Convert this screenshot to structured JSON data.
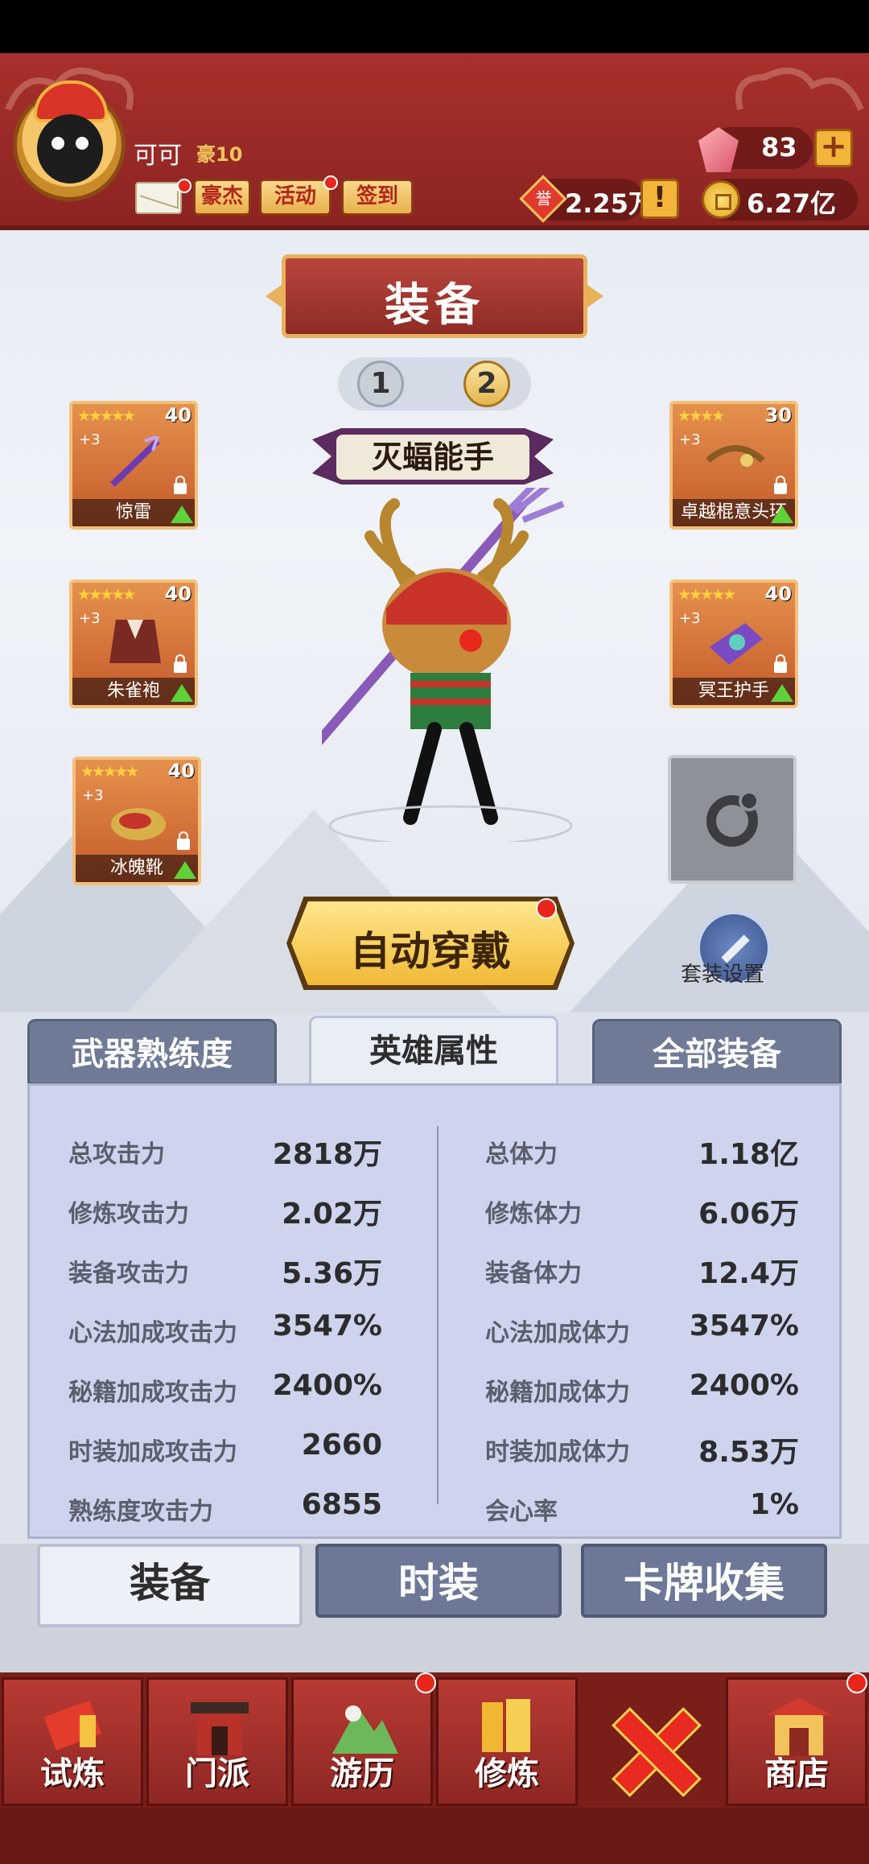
{
  "header": {
    "player_name": "可可",
    "vip_level": "豪10",
    "buttons": {
      "hero": "豪杰",
      "event": "活动",
      "checkin": "签到"
    },
    "gems": "83",
    "honor": "2.25万",
    "gold": "6.27亿"
  },
  "screen": {
    "title": "装备",
    "pages": [
      "1",
      "2"
    ],
    "hero_title": "灭蝠能手",
    "auto_equip": "自动穿戴",
    "set_settings": "套装设置"
  },
  "equipment": [
    {
      "name": "惊雷",
      "level": "40",
      "stars": "★★★★★",
      "plus": "+3"
    },
    {
      "name": "朱雀袍",
      "level": "40",
      "stars": "★★★★★",
      "plus": "+3"
    },
    {
      "name": "冰魄靴",
      "level": "40",
      "stars": "★★★★★",
      "plus": "+3"
    },
    {
      "name": "卓越棍意头环",
      "level": "30",
      "stars": "★★★★",
      "plus": "+3"
    },
    {
      "name": "冥王护手",
      "level": "40",
      "stars": "★★★★★",
      "plus": "+3"
    }
  ],
  "stat_tabs": [
    "武器熟练度",
    "英雄属性",
    "全部装备"
  ],
  "stats_left": [
    {
      "label": "总攻击力",
      "value": "2818万"
    },
    {
      "label": "修炼攻击力",
      "value": "2.02万"
    },
    {
      "label": "装备攻击力",
      "value": "5.36万"
    },
    {
      "label": "心法加成攻击力",
      "value": "3547%"
    },
    {
      "label": "秘籍加成攻击力",
      "value": "2400%"
    },
    {
      "label": "时装加成攻击力",
      "value": "2660"
    },
    {
      "label": "熟练度攻击力",
      "value": "6855"
    }
  ],
  "stats_right": [
    {
      "label": "总体力",
      "value": "1.18亿"
    },
    {
      "label": "修炼体力",
      "value": "6.06万"
    },
    {
      "label": "装备体力",
      "value": "12.4万"
    },
    {
      "label": "心法加成体力",
      "value": "3547%"
    },
    {
      "label": "秘籍加成体力",
      "value": "2400%"
    },
    {
      "label": "时装加成体力",
      "value": "8.53万"
    },
    {
      "label": "会心率",
      "value": "1%"
    }
  ],
  "bottom_tabs": [
    "装备",
    "时装",
    "卡牌收集"
  ],
  "nav": [
    "试炼",
    "门派",
    "游历",
    "修炼",
    "商店"
  ]
}
